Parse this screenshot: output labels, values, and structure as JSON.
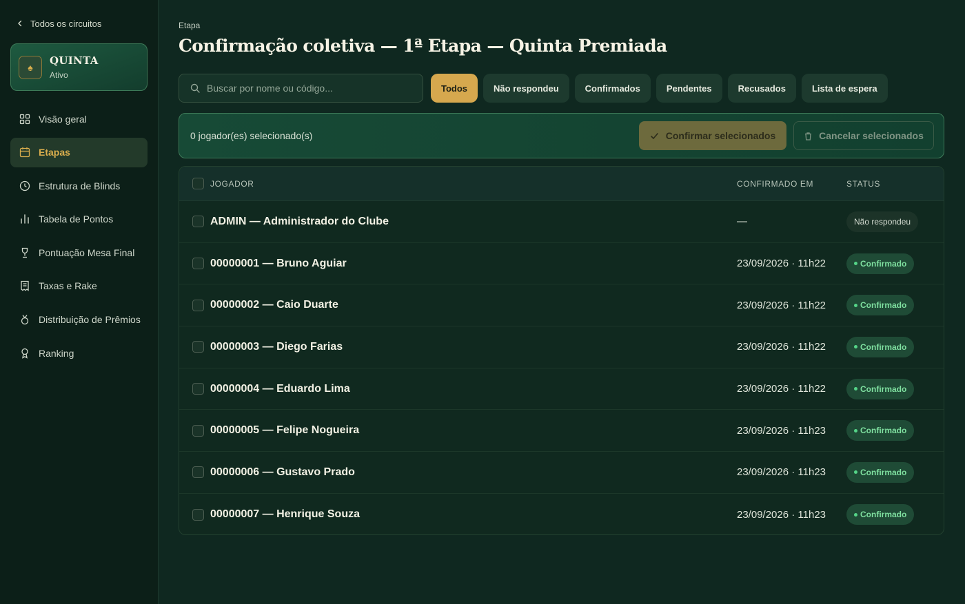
{
  "sidebar": {
    "back_label": "Todos os circuitos",
    "circuit": {
      "name": "QUINTA",
      "status": "Ativo"
    },
    "items": [
      {
        "label": "Visão geral",
        "icon": "grid-icon",
        "active": false
      },
      {
        "label": "Etapas",
        "icon": "calendar-icon",
        "active": true
      },
      {
        "label": "Estrutura de Blinds",
        "icon": "clock-icon",
        "active": false
      },
      {
        "label": "Tabela de Pontos",
        "icon": "bar-chart-icon",
        "active": false
      },
      {
        "label": "Pontuação Mesa Final",
        "icon": "trophy-icon",
        "active": false
      },
      {
        "label": "Taxas e Rake",
        "icon": "receipt-icon",
        "active": false
      },
      {
        "label": "Distribuição de Prêmios",
        "icon": "medal-icon",
        "active": false
      },
      {
        "label": "Ranking",
        "icon": "award-icon",
        "active": false
      }
    ]
  },
  "header": {
    "eyebrow": "Etapa",
    "title": "Confirmação coletiva — 1ª Etapa — Quinta Premiada"
  },
  "search": {
    "placeholder": "Buscar por nome ou código..."
  },
  "filters": [
    {
      "label": "Todos",
      "active": true
    },
    {
      "label": "Não respondeu",
      "active": false
    },
    {
      "label": "Confirmados",
      "active": false
    },
    {
      "label": "Pendentes",
      "active": false
    },
    {
      "label": "Recusados",
      "active": false
    },
    {
      "label": "Lista de espera",
      "active": false
    }
  ],
  "bulk": {
    "count_text": "0 jogador(es) selecionado(s)",
    "confirm_label": "Confirmar selecionados",
    "cancel_label": "Cancelar selecionados"
  },
  "table": {
    "columns": {
      "player": "JOGADOR",
      "confirmed_at": "CONFIRMADO EM",
      "status": "STATUS"
    },
    "rows": [
      {
        "player": "ADMIN — Administrador do Clube",
        "confirmed_at": "—",
        "status": "Não respondeu",
        "status_type": "none"
      },
      {
        "player": "00000001 — Bruno Aguiar",
        "confirmed_at": "23/09/2026 · 11h22",
        "status": "Confirmado",
        "status_type": "ok"
      },
      {
        "player": "00000002 — Caio Duarte",
        "confirmed_at": "23/09/2026 · 11h22",
        "status": "Confirmado",
        "status_type": "ok"
      },
      {
        "player": "00000003 — Diego Farias",
        "confirmed_at": "23/09/2026 · 11h22",
        "status": "Confirmado",
        "status_type": "ok"
      },
      {
        "player": "00000004 — Eduardo Lima",
        "confirmed_at": "23/09/2026 · 11h22",
        "status": "Confirmado",
        "status_type": "ok"
      },
      {
        "player": "00000005 — Felipe Nogueira",
        "confirmed_at": "23/09/2026 · 11h23",
        "status": "Confirmado",
        "status_type": "ok"
      },
      {
        "player": "00000006 — Gustavo Prado",
        "confirmed_at": "23/09/2026 · 11h23",
        "status": "Confirmado",
        "status_type": "ok"
      },
      {
        "player": "00000007 — Henrique Souza",
        "confirmed_at": "23/09/2026 · 11h23",
        "status": "Confirmado",
        "status_type": "ok"
      }
    ]
  },
  "colors": {
    "accent_gold": "#d6a84e",
    "confirmed_green": "#7fe0a0",
    "background": "#0f2820"
  }
}
